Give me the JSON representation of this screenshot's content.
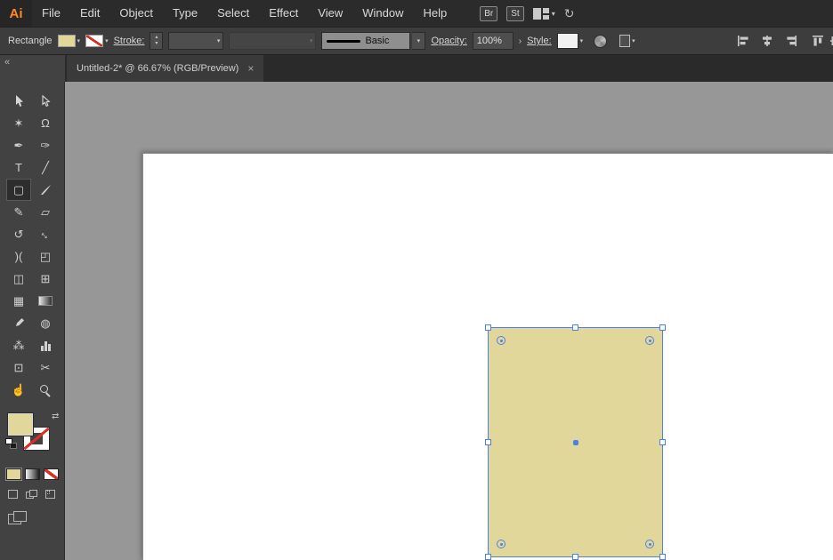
{
  "app": {
    "name": "Ai"
  },
  "menubar": {
    "items": [
      "File",
      "Edit",
      "Object",
      "Type",
      "Select",
      "Effect",
      "View",
      "Window",
      "Help"
    ],
    "br_label": "Br",
    "st_label": "St"
  },
  "controlbar": {
    "tool_name": "Rectangle",
    "stroke_label": "Stroke:",
    "brush_name": "Basic",
    "opacity_label": "Opacity:",
    "opacity_value": "100%",
    "style_label": "Style:"
  },
  "tab": {
    "title": "Untitled-2* @ 66.67% (RGB/Preview)",
    "close_glyph": "×"
  },
  "icons": {
    "collapse": "«",
    "chevron_down": "▾",
    "stepper_up": "▴",
    "stepper_down": "▾",
    "opacity_spinner": "›",
    "swap_fill_stroke": "⇄",
    "sync": "↻",
    "magic_wand": "✶",
    "lasso": "Ω",
    "pen": "✒",
    "curvature": "✑",
    "type_tool": "T",
    "line_segment": "╱",
    "rectangle_tool": "▢",
    "pencil": "✎",
    "eraser": "▱",
    "rotate": "↺",
    "scale": "↔",
    "width_tool": ")(",
    "free_transform": "◰",
    "shape_builder": "◫",
    "perspective_grid": "⊞",
    "mesh": "▦",
    "blend": "◍",
    "symbol_sprayer": "⁂",
    "artboard_tool": "⊡",
    "slice": "✂",
    "hand": "☝"
  },
  "colors": {
    "selection_blue": "#4a82e8",
    "fill_tan": "#e2d79b",
    "none_red": "#d93025",
    "canvas_gray": "#979797",
    "chrome_dark": "#2b2b2b"
  },
  "document": {
    "zoom_percent": "66.67%",
    "color_mode": "RGB",
    "view_mode": "Preview",
    "shape_fill": "#e2d79b"
  }
}
